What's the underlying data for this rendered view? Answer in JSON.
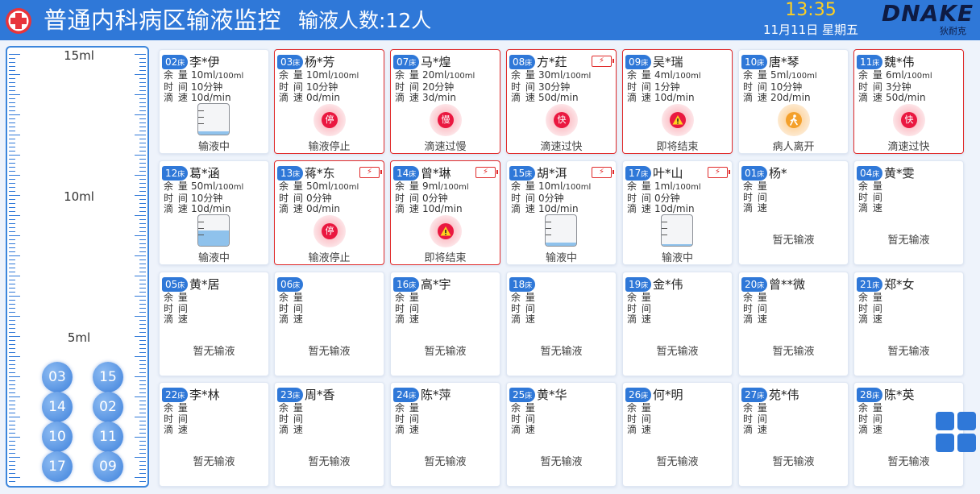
{
  "header": {
    "title": "普通内科病区输液监控",
    "count_label": "输液人数:12人",
    "time": "13:35",
    "date": "11月11日 星期五",
    "brand": "DNAKE",
    "brand_sub": "狄耐克",
    "logo_icon": "medical-cross-icon"
  },
  "gauge": {
    "labels": [
      "15ml",
      "10ml",
      "5ml"
    ],
    "beds": [
      "03",
      "15",
      "14",
      "02",
      "10",
      "11",
      "17",
      "09"
    ]
  },
  "labels": {
    "remaining": "余 量",
    "time": "时 间",
    "speed": "滴 速",
    "bed_suffix": "床"
  },
  "colors": {
    "primary": "#2f78d8",
    "alert": "#e02b2b",
    "clock": "#ffd021",
    "warn": "#f4a02a"
  },
  "cards": [
    {
      "bed": "02",
      "name": "李*伊",
      "vol": "10ml",
      "total": "/100ml",
      "time": "10分钟",
      "speed": "10d/min",
      "status": "输液中",
      "kind": "bottle",
      "level": 0.1,
      "battery": false
    },
    {
      "bed": "03",
      "name": "杨*芳",
      "vol": "10ml",
      "total": "/100ml",
      "time": "10分钟",
      "speed": "0d/min",
      "status": "输液停止",
      "kind": "icon",
      "icon": "stop",
      "icon_text": "停",
      "alert": true,
      "battery": false
    },
    {
      "bed": "07",
      "name": "马*煌",
      "vol": "20ml",
      "total": "/100ml",
      "time": "20分钟",
      "speed": "3d/min",
      "status": "滴速过慢",
      "kind": "icon",
      "icon": "slow",
      "icon_text": "慢",
      "alert": true,
      "battery": false
    },
    {
      "bed": "08",
      "name": "方*荭",
      "vol": "30ml",
      "total": "/100ml",
      "time": "30分钟",
      "speed": "50d/min",
      "status": "滴速过快",
      "kind": "icon",
      "icon": "fast",
      "icon_text": "快",
      "alert": true,
      "battery": true
    },
    {
      "bed": "09",
      "name": "吴*瑞",
      "vol": "4ml",
      "total": "/100ml",
      "time": "1分钟",
      "speed": "10d/min",
      "status": "即将结束",
      "kind": "icon",
      "icon": "warning",
      "icon_text": "!",
      "alert": true,
      "battery": false
    },
    {
      "bed": "10",
      "name": "唐*琴",
      "vol": "5ml",
      "total": "/100ml",
      "time": "10分钟",
      "speed": "20d/min",
      "status": "病人离开",
      "kind": "icon",
      "icon": "leave",
      "icon_text": "走",
      "alert": false,
      "battery": false
    },
    {
      "bed": "11",
      "name": "魏*伟",
      "vol": "6ml",
      "total": "/100ml",
      "time": "3分钟",
      "speed": "50d/min",
      "status": "滴速过快",
      "kind": "icon",
      "icon": "fast",
      "icon_text": "快",
      "alert": true,
      "battery": false
    },
    {
      "bed": "12",
      "name": "葛*涵",
      "vol": "50ml",
      "total": "/100ml",
      "time": "10分钟",
      "speed": "10d/min",
      "status": "输液中",
      "kind": "bottle",
      "level": 0.5,
      "battery": false
    },
    {
      "bed": "13",
      "name": "蒋*东",
      "vol": "50ml",
      "total": "/100ml",
      "time": "0分钟",
      "speed": "0d/min",
      "status": "输液停止",
      "kind": "icon",
      "icon": "stop",
      "icon_text": "停",
      "alert": true,
      "battery": true
    },
    {
      "bed": "14",
      "name": "曾*琳",
      "vol": "9ml",
      "total": "/100ml",
      "time": "0分钟",
      "speed": "10d/min",
      "status": "即将结束",
      "kind": "icon",
      "icon": "warning",
      "icon_text": "!",
      "alert": true,
      "battery": true
    },
    {
      "bed": "15",
      "name": "胡*洱",
      "vol": "10ml",
      "total": "/100ml",
      "time": "0分钟",
      "speed": "10d/min",
      "status": "输液中",
      "kind": "bottle",
      "level": 0.1,
      "battery": true
    },
    {
      "bed": "17",
      "name": "叶*山",
      "vol": "1ml",
      "total": "/100ml",
      "time": "0分钟",
      "speed": "10d/min",
      "status": "输液中",
      "kind": "bottle",
      "level": 0.02,
      "battery": true
    },
    {
      "bed": "01",
      "name": "杨*",
      "status": "暂无输液",
      "kind": "empty"
    },
    {
      "bed": "04",
      "name": "黄*雯",
      "status": "暂无输液",
      "kind": "empty"
    },
    {
      "bed": "05",
      "name": "黄*居",
      "status": "暂无输液",
      "kind": "empty"
    },
    {
      "bed": "06",
      "name": "",
      "status": "暂无输液",
      "kind": "empty"
    },
    {
      "bed": "16",
      "name": "高*宇",
      "status": "暂无输液",
      "kind": "empty"
    },
    {
      "bed": "18",
      "name": "",
      "status": "暂无输液",
      "kind": "empty"
    },
    {
      "bed": "19",
      "name": "金*伟",
      "status": "暂无输液",
      "kind": "empty"
    },
    {
      "bed": "20",
      "name": "曾**微",
      "status": "暂无输液",
      "kind": "empty"
    },
    {
      "bed": "21",
      "name": "郑*女",
      "status": "暂无输液",
      "kind": "empty"
    },
    {
      "bed": "22",
      "name": "李*林",
      "status": "暂无输液",
      "kind": "empty"
    },
    {
      "bed": "23",
      "name": "周*香",
      "status": "暂无输液",
      "kind": "empty"
    },
    {
      "bed": "24",
      "name": "陈*萍",
      "status": "暂无输液",
      "kind": "empty"
    },
    {
      "bed": "25",
      "name": "黄*华",
      "status": "暂无输液",
      "kind": "empty"
    },
    {
      "bed": "26",
      "name": "何*明",
      "status": "暂无输液",
      "kind": "empty"
    },
    {
      "bed": "27",
      "name": "苑*伟",
      "status": "暂无输液",
      "kind": "empty"
    },
    {
      "bed": "28",
      "name": "陈*英",
      "status": "暂无输液",
      "kind": "empty"
    }
  ],
  "grid_button_icon": "grid-view-icon"
}
